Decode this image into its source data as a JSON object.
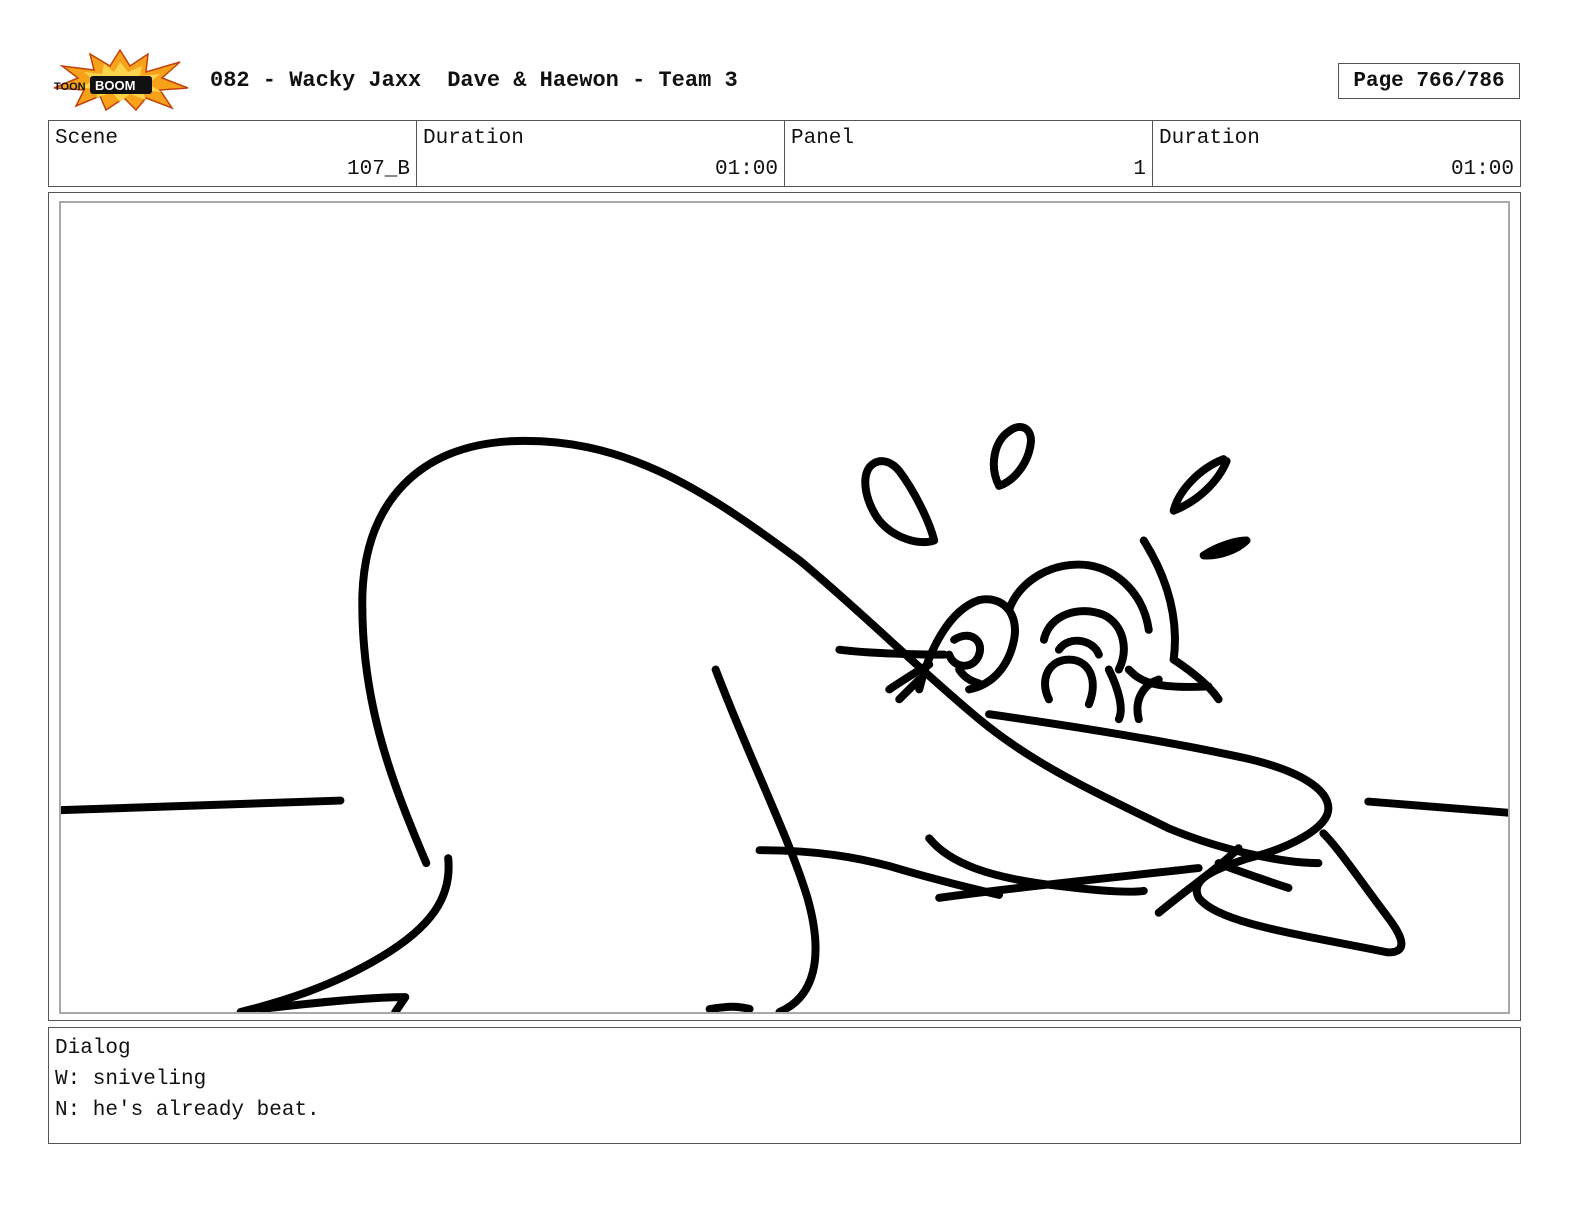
{
  "logo": {
    "text_top": "TOON",
    "text_main": "BOOM",
    "colors": {
      "burst": "#f7a21b",
      "burst_inner": "#fcd34d",
      "ink": "#111111"
    }
  },
  "header": {
    "episode": "082 - Wacky Jaxx",
    "team": "Dave & Haewon - Team 3",
    "page": "Page 766/786"
  },
  "info": {
    "scene_label": "Scene",
    "scene_value": "107_B",
    "duration_label": "Duration",
    "duration_value": "01:00",
    "panel_label": "Panel",
    "panel_value": "1",
    "panel_duration_label": "Duration",
    "panel_duration_value": "01:00"
  },
  "panel": {
    "drawing_icon": "storyboard-sketch-crouching-character-icon"
  },
  "dialog": {
    "label": "Dialog",
    "lines": [
      "W: sniveling",
      "N: he's already beat."
    ]
  }
}
